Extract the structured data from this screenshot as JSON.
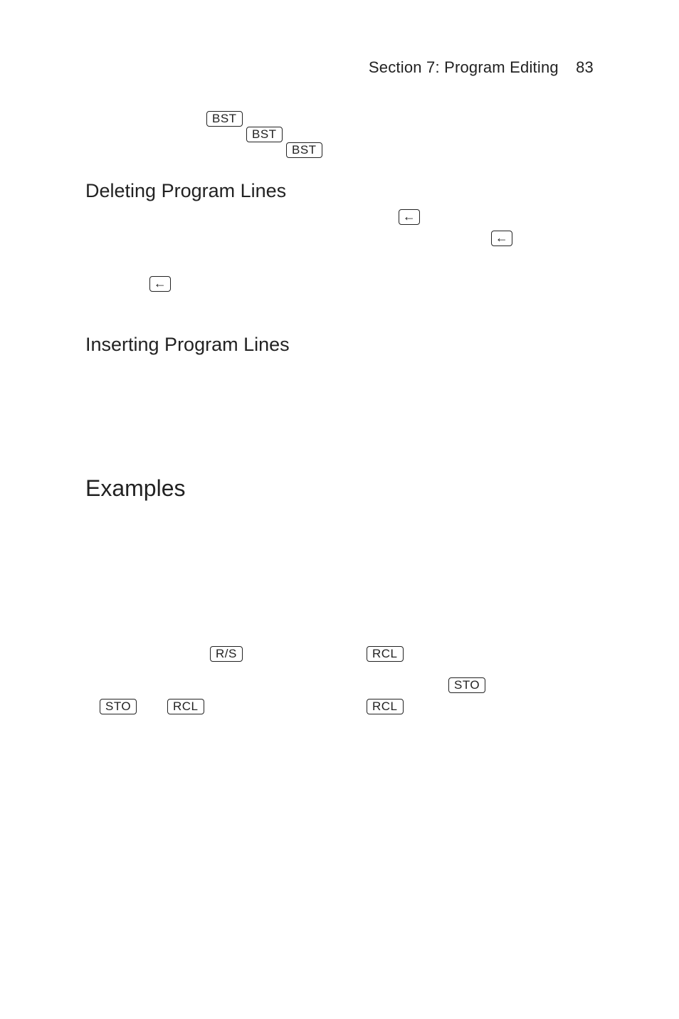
{
  "header": {
    "section_label": "Section 7: Program Editing",
    "page_number": "83"
  },
  "keys": {
    "bst": "BST",
    "back": "←",
    "rs": "R/S",
    "rcl": "RCL",
    "sto": "STO"
  },
  "headings": {
    "deleting": "Deleting Program Lines",
    "inserting": "Inserting Program Lines",
    "examples": "Examples"
  }
}
